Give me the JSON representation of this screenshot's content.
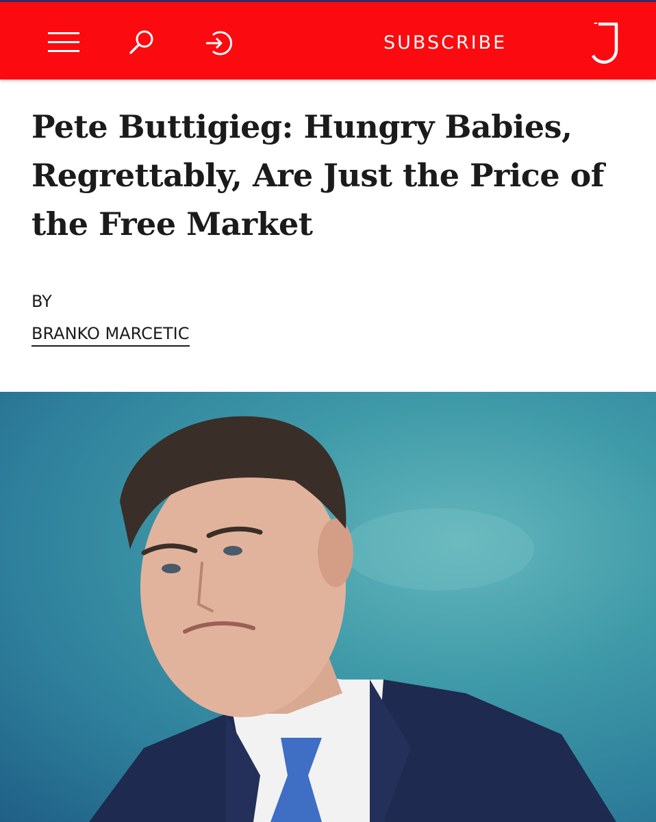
{
  "header": {
    "menu_icon": "hamburger-menu-icon",
    "search_icon": "search-icon",
    "signin_icon": "sign-in-icon",
    "subscribe_label": "SUBSCRIBE",
    "logo_icon": "jacobin-j-logo",
    "colors": {
      "background": "#fb0b10",
      "foreground": "#ffffff",
      "top_rule": "#3a2a63"
    }
  },
  "article": {
    "title": "Pete Buttigieg: Hungry Babies, Regrettably, Are Just the Price of the Free Market",
    "byline_prefix": "BY",
    "author": "BRANKO MARCETIC"
  },
  "hero_image": {
    "subject": "photo-of-man-in-suit",
    "colors": {
      "backdrop": "#3f9aa8",
      "suit": "#1e2a4f",
      "tie": "#3f6fc4"
    }
  }
}
